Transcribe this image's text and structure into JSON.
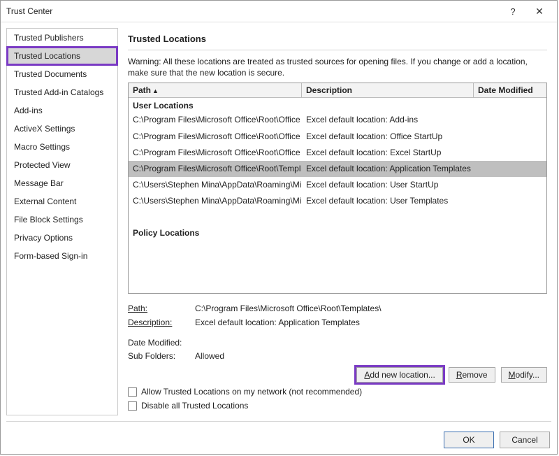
{
  "window": {
    "title": "Trust Center",
    "help_icon": "?",
    "close_icon": "✕"
  },
  "sidebar": {
    "items": [
      {
        "label": "Trusted Publishers"
      },
      {
        "label": "Trusted Locations",
        "selected": true,
        "highlight": true
      },
      {
        "label": "Trusted Documents"
      },
      {
        "label": "Trusted Add-in Catalogs"
      },
      {
        "label": "Add-ins"
      },
      {
        "label": "ActiveX Settings"
      },
      {
        "label": "Macro Settings"
      },
      {
        "label": "Protected View"
      },
      {
        "label": "Message Bar"
      },
      {
        "label": "External Content"
      },
      {
        "label": "File Block Settings"
      },
      {
        "label": "Privacy Options"
      },
      {
        "label": "Form-based Sign-in"
      }
    ]
  },
  "main": {
    "heading": "Trusted Locations",
    "warning": "Warning: All these locations are treated as trusted sources for opening files.  If you change or add a location, make sure that the new location is secure.",
    "columns": {
      "path": "Path",
      "desc": "Description",
      "date": "Date Modified"
    },
    "sections": [
      {
        "title": "User Locations",
        "rows": [
          {
            "path": "C:\\Program Files\\Microsoft Office\\Root\\Office",
            "desc": "Excel default location: Add-ins"
          },
          {
            "path": "C:\\Program Files\\Microsoft Office\\Root\\Office",
            "desc": "Excel default location: Office StartUp"
          },
          {
            "path": "C:\\Program Files\\Microsoft Office\\Root\\Office",
            "desc": "Excel default location: Excel StartUp"
          },
          {
            "path": "C:\\Program Files\\Microsoft Office\\Root\\Templ",
            "desc": "Excel default location: Application Templates",
            "selected": true
          },
          {
            "path": "C:\\Users\\Stephen Mina\\AppData\\Roaming\\Mi",
            "desc": "Excel default location: User StartUp"
          },
          {
            "path": "C:\\Users\\Stephen Mina\\AppData\\Roaming\\Mi",
            "desc": "Excel default location: User Templates"
          }
        ]
      },
      {
        "title": "Policy Locations",
        "rows": []
      }
    ],
    "details": {
      "path_label": "Path:",
      "path_value": "C:\\Program Files\\Microsoft Office\\Root\\Templates\\",
      "desc_label": "Description:",
      "desc_value": "Excel default location: Application Templates",
      "date_label": "Date Modified:",
      "date_value": "",
      "subfolders_label": "Sub Folders:",
      "subfolders_value": "Allowed"
    },
    "buttons": {
      "add": "Add new location...",
      "remove": "Remove",
      "modify": "Modify..."
    },
    "checkboxes": {
      "allow_network": "Allow Trusted Locations on my network (not recommended)",
      "disable_all": "Disable all Trusted Locations"
    }
  },
  "footer": {
    "ok": "OK",
    "cancel": "Cancel"
  }
}
